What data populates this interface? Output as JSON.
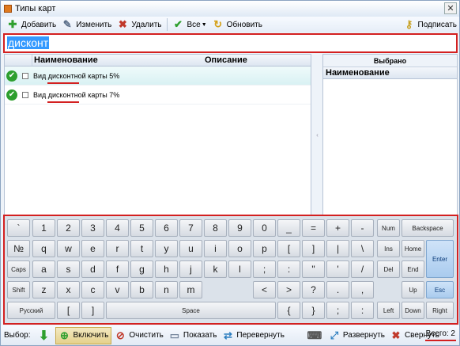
{
  "window": {
    "title": "Типы карт"
  },
  "toolbar": {
    "add": "Добавить",
    "edit": "Изменить",
    "delete": "Удалить",
    "all": "Все",
    "refresh": "Обновить",
    "sign": "Подписать"
  },
  "search": {
    "value": "дисконт"
  },
  "grid": {
    "columns": [
      "Наименование",
      "Описание"
    ],
    "rows": [
      {
        "name": "Вид дисконтной карты 5%",
        "description": ""
      },
      {
        "name": "Вид дисконтной карты 7%",
        "description": ""
      }
    ]
  },
  "selected_panel": {
    "header": "Выбрано",
    "column": "Наименование"
  },
  "keyboard": {
    "rows": [
      [
        "`",
        "1",
        "2",
        "3",
        "4",
        "5",
        "6",
        "7",
        "8",
        "9",
        "0",
        "_",
        "=",
        "+",
        "-",
        "Num",
        "Backspace"
      ],
      [
        "№",
        "q",
        "w",
        "e",
        "r",
        "t",
        "y",
        "u",
        "i",
        "o",
        "p",
        "[",
        "]",
        "|",
        "\\",
        "Ins",
        "Home",
        "Enter"
      ],
      [
        "Caps",
        "a",
        "s",
        "d",
        "f",
        "g",
        "h",
        "j",
        "k",
        "l",
        ";",
        ":",
        "\"",
        "'",
        "/",
        "Del",
        "End"
      ],
      [
        "Shift",
        "z",
        "x",
        "c",
        "v",
        "b",
        "n",
        "m",
        "<",
        ">",
        "?",
        ".",
        ",",
        "Up",
        "Esc"
      ],
      [
        "Русский",
        "[",
        "]",
        "Space",
        "{",
        "}",
        ";",
        ":",
        "Left",
        "Down",
        "Right"
      ]
    ]
  },
  "statusbar": {
    "select_label": "Выбор:",
    "include": "Включить",
    "clear": "Очистить",
    "show": "Показать",
    "flip": "Перевернуть",
    "expand": "Развернуть",
    "collapse": "Свернуть",
    "total": "Всего: 2"
  },
  "colors": {
    "highlight": "#d32020",
    "selection": "#3399ff",
    "check": "#2e9f2e"
  }
}
